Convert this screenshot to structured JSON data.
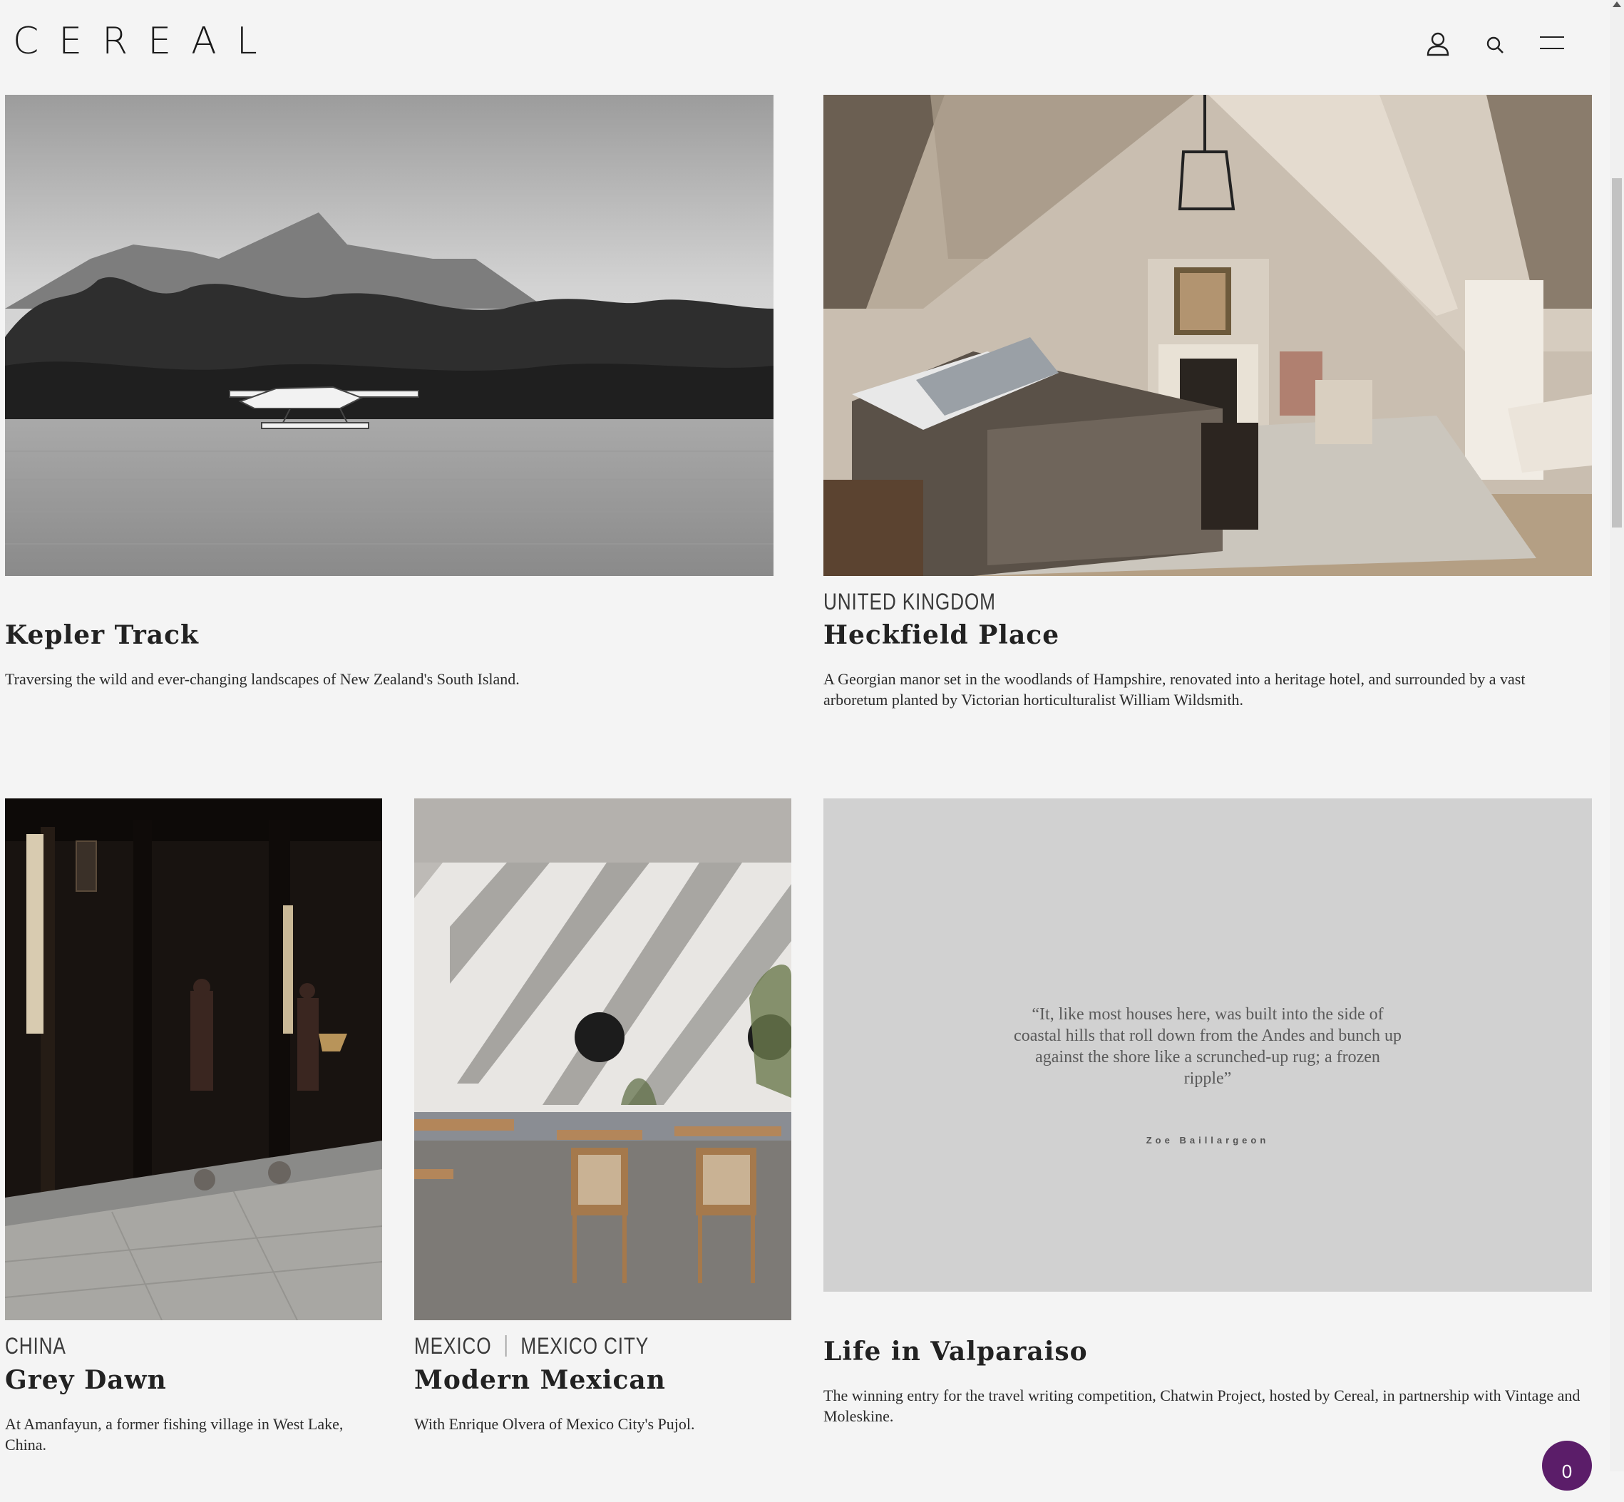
{
  "brand": {
    "logo": "CEREAL"
  },
  "header": {
    "icons": [
      "user-icon",
      "search-icon",
      "menu-icon"
    ]
  },
  "cards": [
    {
      "category": "",
      "title": "Kepler Track",
      "description": "Traversing the wild and ever-changing landscapes of New Zealand's South Island."
    },
    {
      "category": "UNITED KINGDOM",
      "title": "Heckfield Place",
      "description": "A Georgian manor set in the woodlands of Hampshire, renovated into a heritage hotel, and surrounded by a vast arboretum planted by Victorian horticulturalist William Wildsmith."
    },
    {
      "category": "CHINA",
      "title": "Grey Dawn",
      "description": "At Amanfayun, a former fishing village in West Lake, China."
    },
    {
      "category": "MEXICO",
      "category2": "MEXICO CITY",
      "title": "Modern Mexican",
      "description": "With Enrique Olvera of Mexico City's Pujol."
    },
    {
      "category": "",
      "title": "Life in Valparaiso",
      "description": "The winning entry for the travel writing competition, Chatwin Project, hosted by Cereal, in partnership with Vintage and Moleskine."
    }
  ],
  "quote": {
    "text": "“It, like most houses here, was built into the side of coastal hills that roll down from the Andes and bunch up against the shore like a scrunched-up rug; a frozen ripple”",
    "author": "Zoe Baillargeon"
  },
  "chat_badge": {
    "count": "0"
  },
  "colors": {
    "background": "#f4f4f4",
    "quote_panel": "#d1d1d1",
    "badge": "#5b1d69"
  }
}
